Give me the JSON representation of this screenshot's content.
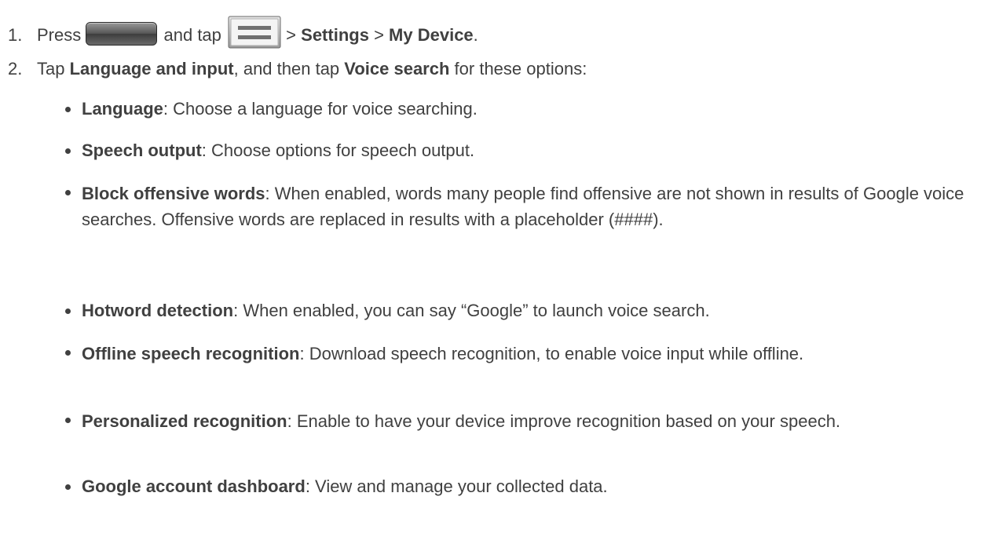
{
  "steps": [
    {
      "num": "1.",
      "t1": "Press",
      "home_button_icon": "home-button",
      "t2": "and tap",
      "menu_button_icon": "menu-button",
      "t3": ">",
      "b1": "Settings",
      "t4": ">",
      "b2": "My Device",
      "t5": "."
    },
    {
      "num": "2.",
      "t1": "Tap",
      "b1": "Language and input",
      "t2": ", and then tap",
      "b2": "Voice search",
      "t3": "for these options:"
    }
  ],
  "options": [
    {
      "term": "Language",
      "desc": ": Choose a language for voice searching."
    },
    {
      "term": "Speech output",
      "desc": ": Choose options for speech output."
    },
    {
      "term": "Block offensive words",
      "desc": ": When enabled, words many people find offensive are not shown in results of Google voice searches. Offensive words are replaced in results with a placeholder (####)."
    },
    {
      "term": "Hotword detection",
      "desc": ": When enabled, you can say “Google” to launch voice search."
    },
    {
      "term": "Offline speech recognition",
      "desc": ": Download speech recognition, to enable voice input while offline."
    },
    {
      "term": "Personalized recognition",
      "desc": ": Enable to have your device improve recognition based on your speech."
    },
    {
      "term": "Google account dashboard",
      "desc": ": View and manage your collected data."
    }
  ]
}
